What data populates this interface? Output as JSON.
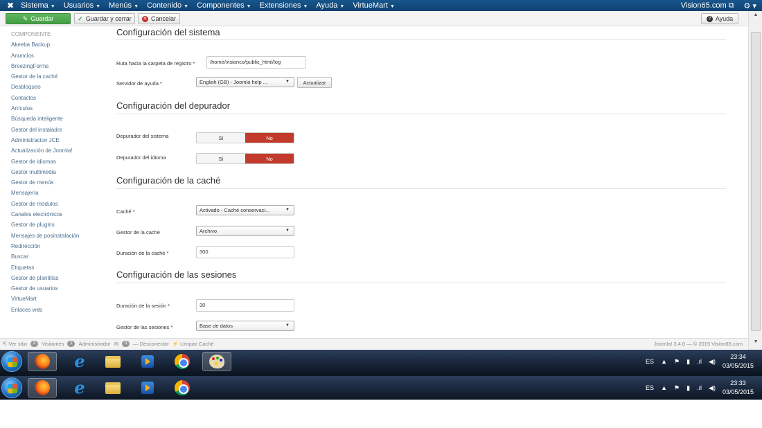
{
  "topbar": {
    "menu": [
      {
        "label": "Sistema"
      },
      {
        "label": "Usuarios"
      },
      {
        "label": "Menús"
      },
      {
        "label": "Contenido"
      },
      {
        "label": "Componentes"
      },
      {
        "label": "Extensiones"
      },
      {
        "label": "Ayuda"
      },
      {
        "label": "VirtueMart"
      }
    ],
    "site_link": "Vision65.com"
  },
  "toolbar": {
    "save_label": "Guardar",
    "save_close_label": "Guardar y cerrar",
    "cancel_label": "Cancelar",
    "help_label": "Ayuda"
  },
  "sidebar": {
    "heading": "COMPONENTE",
    "items": [
      "Akeeba Backup",
      "Anuncios",
      "BreezingForms",
      "Gestor de la caché",
      "Desbloqueo",
      "Contactos",
      "Artículos",
      "Búsqueda inteligente",
      "Gestor del instalador",
      "Administracion JCE",
      "Actualización de Joomla!",
      "Gestor de idiomas",
      "Gestor multimedia",
      "Gestor de menús",
      "Mensajería",
      "Gestor de módulos",
      "Canales electrónicos",
      "Gestor de plugins",
      "Mensajes de posinstalación",
      "Redirección",
      "Buscar",
      "Etiquetas",
      "Gestor de plantillas",
      "Gestor de usuarios",
      "VirtueMart",
      "Enlaces web"
    ]
  },
  "system": {
    "title": "Configuración del sistema",
    "log_path_label": "Ruta hacia la carpeta de registro *",
    "log_path_value": "/home/visionco/public_html/log",
    "help_server_label": "Servidor de ayuda *",
    "help_server_value": "English (GB) - Joomla help ...",
    "refresh_label": "Actualizar"
  },
  "debugger": {
    "title": "Configuración del depurador",
    "system_debug_label": "Depurador del sistema",
    "language_debug_label": "Depurador del idioma",
    "yes": "Sí",
    "no": "No"
  },
  "cache": {
    "title": "Configuración de la caché",
    "cache_label": "Caché *",
    "cache_value": "Activado - Caché conservaci...",
    "handler_label": "Gestor de la caché",
    "handler_value": "Archivo",
    "time_label": "Duración de la caché *",
    "time_value": "300"
  },
  "session": {
    "title": "Configuración de las sesiones",
    "lifetime_label": "Duración de la sesión *",
    "lifetime_value": "30",
    "handler_label": "Gestor de las sesiones *",
    "handler_value": "Base de datos"
  },
  "statusbar": {
    "view_site": "Ver sitio",
    "visitors_count": "3",
    "visitors_label": "Visitantes",
    "admins_count": "1",
    "admins_label": "Administrador",
    "messages_count": "0",
    "logout_label": "Desconectar",
    "clear_cache_label": "Limpiar Caché",
    "footer": "Joomla! 3.4.0 — © 2015 Vision65.com"
  },
  "taskbar_top": {
    "lang": "ES",
    "time": "23:34",
    "date": "03/05/2015"
  },
  "taskbar_bottom": {
    "lang": "ES",
    "time": "23:33",
    "date": "03/05/2015"
  }
}
